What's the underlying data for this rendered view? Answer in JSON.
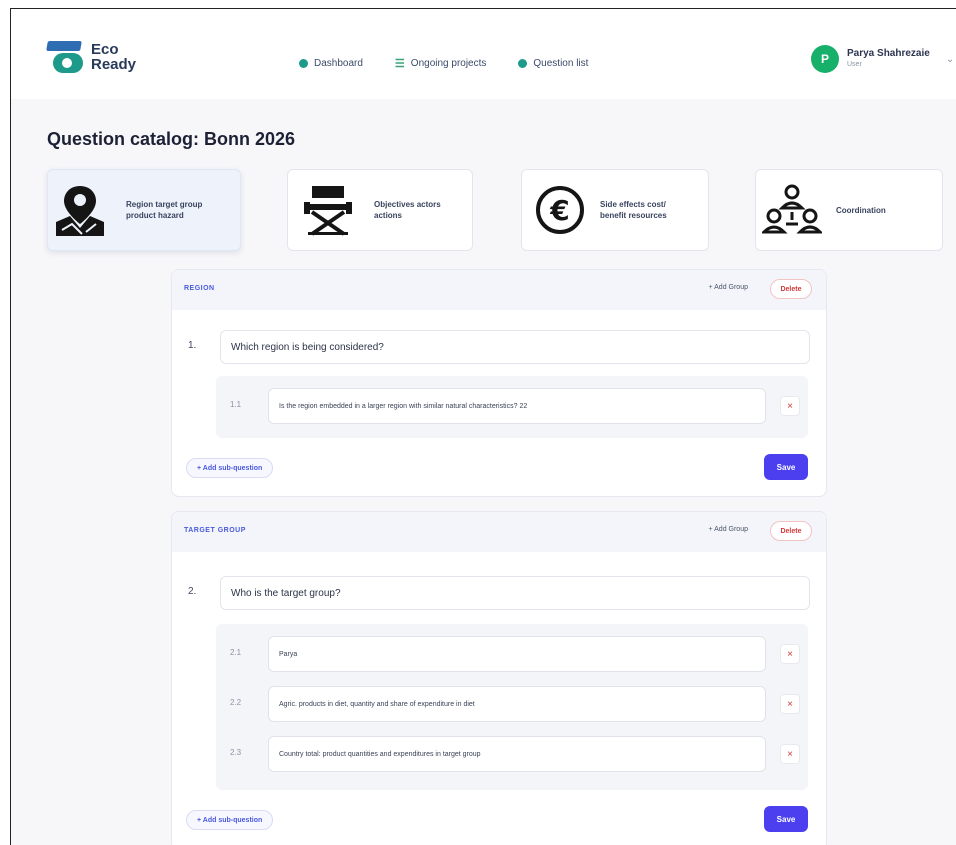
{
  "brand": {
    "line1": "Eco",
    "line2": "Ready"
  },
  "nav": [
    {
      "label": "Dashboard",
      "icon": "pie-chart-icon",
      "color": "#1d9a8a"
    },
    {
      "label": "Ongoing projects",
      "icon": "list-icon",
      "color": "#3aa37a"
    },
    {
      "label": "Question list",
      "icon": "circle-icon",
      "color": "#1d9a8a"
    }
  ],
  "user": {
    "name": "Parya Shahrezaie",
    "role": "User",
    "initial": "P"
  },
  "page": {
    "title": "Question catalog: Bonn 2026"
  },
  "categories": [
    {
      "label": "Region target group product hazard",
      "icon": "map-location-icon",
      "active": true
    },
    {
      "label": "Objectives actors actions",
      "icon": "director-chair-icon",
      "active": false
    },
    {
      "label": "Side effects cost/ benefit resources",
      "icon": "euro-icon",
      "active": false
    },
    {
      "label": "Coordination",
      "icon": "people-network-icon",
      "active": false
    }
  ],
  "groups": [
    {
      "title": "REGION",
      "add_group": "+ Add Group",
      "delete": "Delete",
      "number": "1.",
      "question": "Which region is being considered?",
      "subs": [
        {
          "number": "1.1",
          "text": "Is the region embedded in a larger region with similar natural characteristics? 22"
        }
      ],
      "add_sub": "+ Add sub-question",
      "save": "Save"
    },
    {
      "title": "TARGET GROUP",
      "add_group": "+ Add Group",
      "delete": "Delete",
      "number": "2.",
      "question": "Who is the target group?",
      "subs": [
        {
          "number": "2.1",
          "text": "Parya"
        },
        {
          "number": "2.2",
          "text": "Agric. products in diet, quantity and share of expenditure in diet"
        },
        {
          "number": "2.3",
          "text": "Country total: product quantities and expenditures in target group"
        }
      ],
      "add_sub": "+ Add sub-question",
      "save": "Save"
    }
  ],
  "colors": {
    "accent": "#4b3ff0",
    "danger": "#d23b3b",
    "brand_teal": "#1d9a8a",
    "brand_blue": "#2f6db3"
  }
}
